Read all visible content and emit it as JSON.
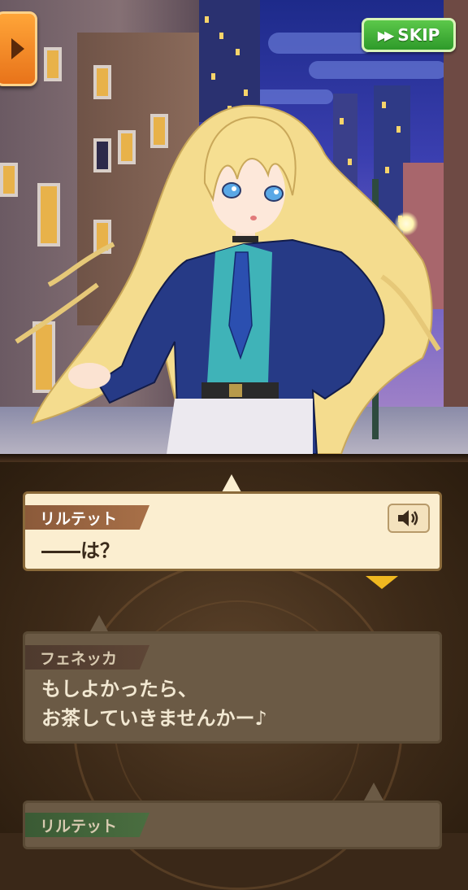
{
  "scene": {
    "location": "night city street"
  },
  "top_bar": {
    "skip_label": "SKIP",
    "skip_icon": "fast-forward-icon",
    "menu_icon": "play-triangle-icon"
  },
  "dialog": {
    "current": {
      "speaker": "リルテット",
      "text": "――は？",
      "voice_icon": "speaker-icon"
    },
    "log": [
      {
        "speaker": "フェネッカ",
        "lines": [
          "もしよかったら、",
          "お茶していきませんかー♪"
        ]
      },
      {
        "speaker": "リルテット"
      }
    ]
  },
  "colors": {
    "skip_green": "#3aa832",
    "menu_orange": "#f08a28",
    "bubble_cream": "#fbeed0",
    "next_arrow": "#f0b820"
  }
}
